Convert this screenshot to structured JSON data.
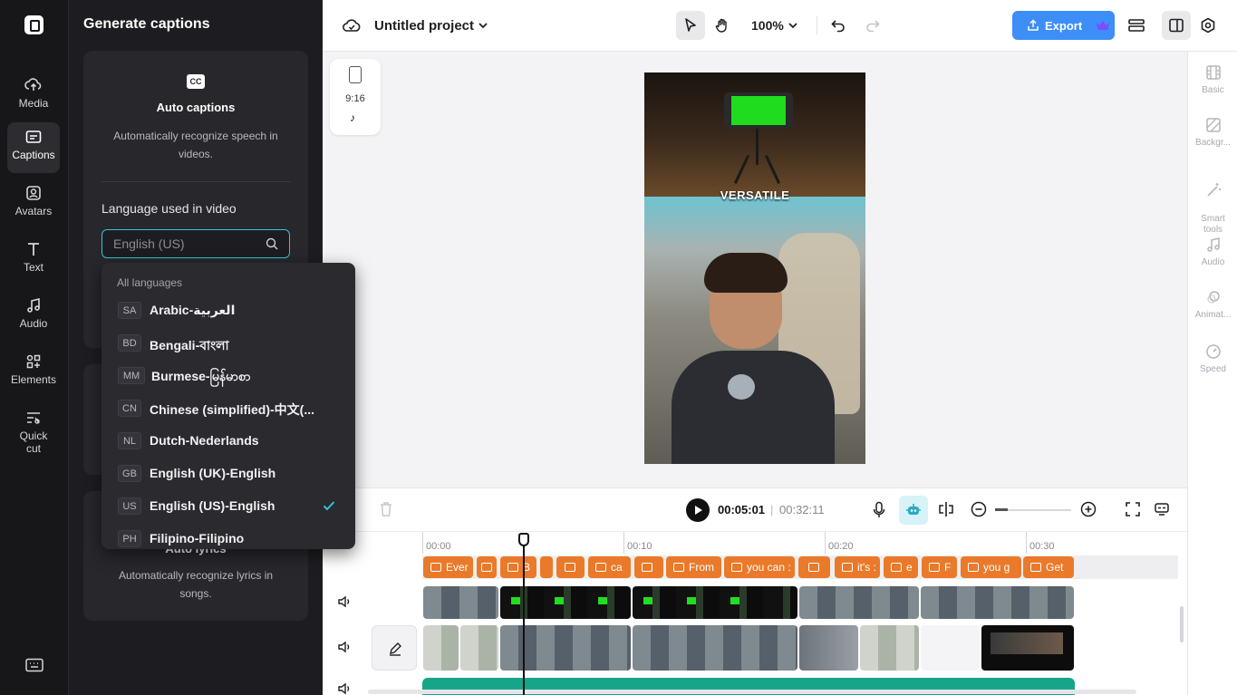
{
  "rail": {
    "items": [
      {
        "label": "Media",
        "icon": "cloud-upload-icon"
      },
      {
        "label": "Captions",
        "icon": "captions-icon"
      },
      {
        "label": "Avatars",
        "icon": "avatar-icon"
      },
      {
        "label": "Text",
        "icon": "text-icon"
      },
      {
        "label": "Audio",
        "icon": "music-note-icon"
      },
      {
        "label": "Elements",
        "icon": "elements-icon"
      },
      {
        "label": "Quick\ncut",
        "icon": "quick-cut-icon"
      }
    ]
  },
  "panel": {
    "title": "Generate captions",
    "auto_captions": {
      "icon_text": "CC",
      "title": "Auto captions",
      "desc": "Automatically recognize speech in videos.",
      "language_label": "Language used in video",
      "language_placeholder": "English (US)"
    },
    "auto_lyrics": {
      "title": "Auto lyrics",
      "desc": "Automatically recognize lyrics in songs."
    }
  },
  "dropdown": {
    "header": "All languages",
    "items": [
      {
        "code": "SA",
        "name": "Arabic-العربية"
      },
      {
        "code": "BD",
        "name": "Bengali-বাংলা"
      },
      {
        "code": "MM",
        "name": "Burmese-မြန်မာစာ"
      },
      {
        "code": "CN",
        "name": "Chinese (simplified)-中文(..."
      },
      {
        "code": "NL",
        "name": "Dutch-Nederlands"
      },
      {
        "code": "GB",
        "name": "English (UK)-English"
      },
      {
        "code": "US",
        "name": "English (US)-English"
      },
      {
        "code": "PH",
        "name": "Filipino-Filipino"
      }
    ],
    "selected_index": 6
  },
  "topbar": {
    "project_title": "Untitled project",
    "zoom": "100%",
    "export_label": "Export"
  },
  "canvas": {
    "ratio": "9:16",
    "ratio_platform": "♪",
    "video_caption": "VERSATILE"
  },
  "props": {
    "items": [
      {
        "label": "Basic",
        "icon": "film-icon"
      },
      {
        "label": "Backgr...",
        "icon": "background-icon"
      },
      {
        "label": "Smart\ntools",
        "icon": "magic-wand-icon"
      },
      {
        "label": "Audio",
        "icon": "music-note-icon"
      },
      {
        "label": "Animat...",
        "icon": "animation-icon"
      },
      {
        "label": "Speed",
        "icon": "speed-icon"
      }
    ]
  },
  "timeline": {
    "current_time": "00:05:01",
    "separator": "|",
    "total_time": "00:32:11",
    "ruler": [
      "00:00",
      "00:10",
      "00:20",
      "00:30"
    ],
    "captions": [
      "Ever",
      "",
      "B",
      "",
      "",
      "ca",
      "",
      "From",
      "you can :",
      "",
      "it's :",
      "e",
      "F",
      "you g",
      "Get"
    ]
  },
  "colors": {
    "accent": "#3d8ef8",
    "caption_clip": "#ea7a2a",
    "audio_track": "#17a58a",
    "input_border": "#39c2d7"
  }
}
